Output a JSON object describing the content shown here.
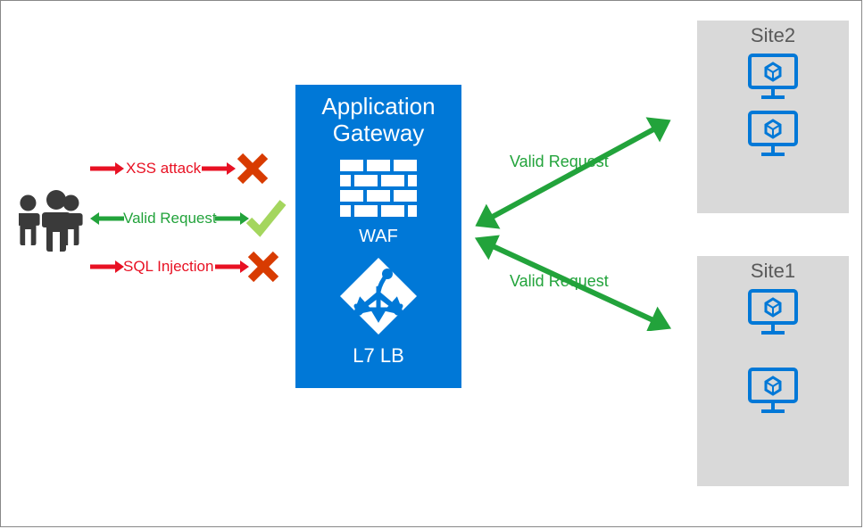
{
  "gateway": {
    "title_line1": "Application",
    "title_line2": "Gateway",
    "waf_label": "WAF",
    "l7_label": "L7 LB"
  },
  "requests": {
    "xss": "XSS attack",
    "valid": "Valid Request",
    "sqli": "SQL Injection"
  },
  "outbound": {
    "valid_top": "Valid Request",
    "valid_bottom": "Valid Request"
  },
  "sites": {
    "site2": "Site2",
    "site1": "Site1"
  },
  "colors": {
    "red": "#e81123",
    "green": "#22a33b",
    "azureBlue": "#0078D7",
    "iconBlue": "#0078D7",
    "rejectRed": "#d83b01",
    "grey": "#d9d9d9",
    "people": "#3a3a3a"
  }
}
